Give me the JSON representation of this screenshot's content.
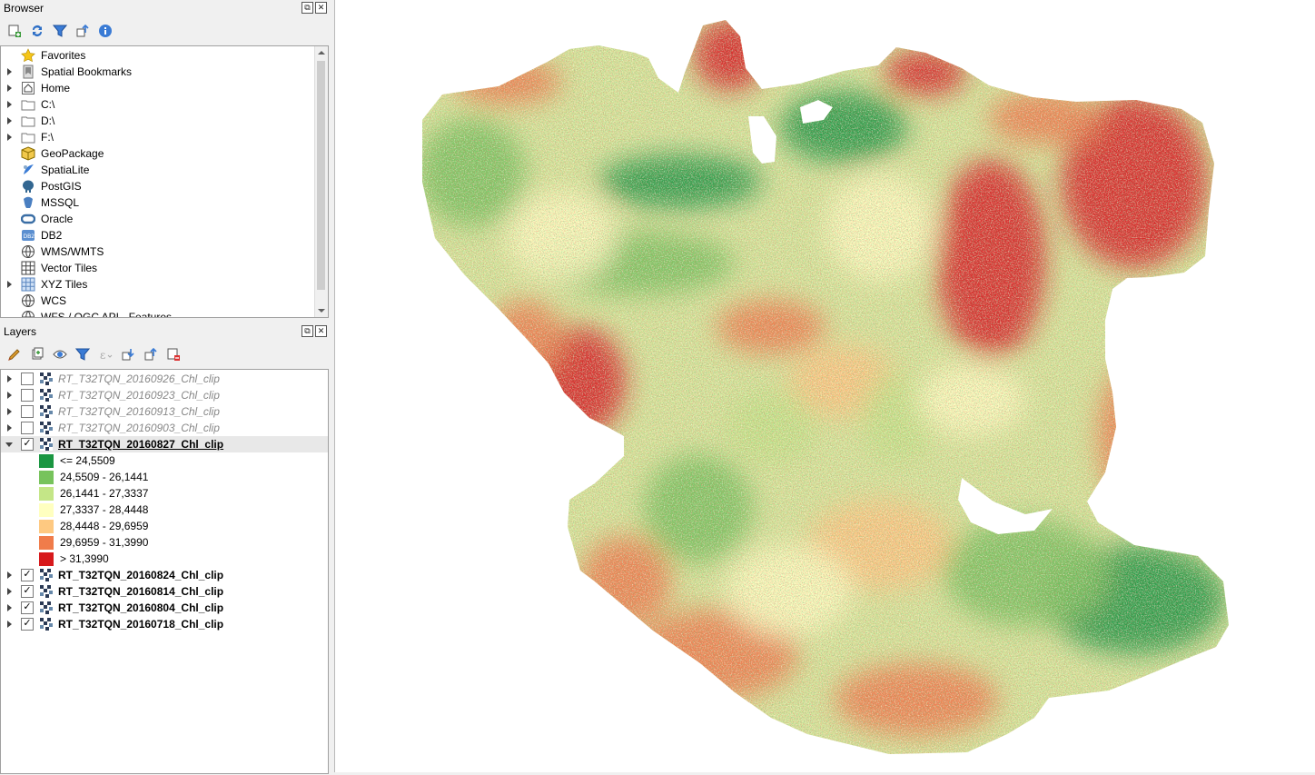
{
  "browser": {
    "title": "Browser",
    "items": [
      {
        "label": "Favorites",
        "icon": "star-icon",
        "expand": false
      },
      {
        "label": "Spatial Bookmarks",
        "icon": "bookmark-icon",
        "expand": true
      },
      {
        "label": "Home",
        "icon": "home-icon",
        "expand": true
      },
      {
        "label": "C:\\",
        "icon": "folder-icon",
        "expand": true
      },
      {
        "label": "D:\\",
        "icon": "folder-icon",
        "expand": true
      },
      {
        "label": "F:\\",
        "icon": "folder-icon",
        "expand": true
      },
      {
        "label": "GeoPackage",
        "icon": "geopackage-icon",
        "expand": false
      },
      {
        "label": "SpatiaLite",
        "icon": "spatialite-icon",
        "expand": false
      },
      {
        "label": "PostGIS",
        "icon": "postgis-icon",
        "expand": false
      },
      {
        "label": "MSSQL",
        "icon": "mssql-icon",
        "expand": false
      },
      {
        "label": "Oracle",
        "icon": "oracle-icon",
        "expand": false
      },
      {
        "label": "DB2",
        "icon": "db2-icon",
        "expand": false
      },
      {
        "label": "WMS/WMTS",
        "icon": "globe-icon",
        "expand": false
      },
      {
        "label": "Vector Tiles",
        "icon": "grid-icon",
        "expand": false
      },
      {
        "label": "XYZ Tiles",
        "icon": "tiles-icon",
        "expand": true
      },
      {
        "label": "WCS",
        "icon": "globe-icon",
        "expand": false
      },
      {
        "label": "WFS / OGC API - Features",
        "icon": "globe-icon",
        "expand": false
      }
    ]
  },
  "layers": {
    "title": "Layers",
    "items": [
      {
        "label": "RT_T32TQN_20160926_Chl_clip",
        "checked": false,
        "expanded": false
      },
      {
        "label": "RT_T32TQN_20160923_Chl_clip",
        "checked": false,
        "expanded": false
      },
      {
        "label": "RT_T32TQN_20160913_Chl_clip",
        "checked": false,
        "expanded": false
      },
      {
        "label": "RT_T32TQN_20160903_Chl_clip",
        "checked": false,
        "expanded": false
      },
      {
        "label": "RT_T32TQN_20160827_Chl_clip",
        "checked": true,
        "expanded": true
      },
      {
        "label": "RT_T32TQN_20160824_Chl_clip",
        "checked": true,
        "expanded": false
      },
      {
        "label": "RT_T32TQN_20160814_Chl_clip",
        "checked": true,
        "expanded": false
      },
      {
        "label": "RT_T32TQN_20160804_Chl_clip",
        "checked": true,
        "expanded": false
      },
      {
        "label": "RT_T32TQN_20160718_Chl_clip",
        "checked": true,
        "expanded": false
      }
    ],
    "legend": [
      {
        "label": "<= 24,5509",
        "color": "#1a9641"
      },
      {
        "label": "24,5509 - 26,1441",
        "color": "#77c35c"
      },
      {
        "label": "26,1441 - 27,3337",
        "color": "#c4e687"
      },
      {
        "label": "27,3337 - 28,4448",
        "color": "#ffffc0"
      },
      {
        "label": "28,4448 - 29,6959",
        "color": "#fec981"
      },
      {
        "label": "29,6959 - 31,3990",
        "color": "#f07c4a"
      },
      {
        "label": "> 31,3990",
        "color": "#d7191c"
      }
    ]
  },
  "dock_buttons": {
    "float": "⧉",
    "close": "✕"
  }
}
